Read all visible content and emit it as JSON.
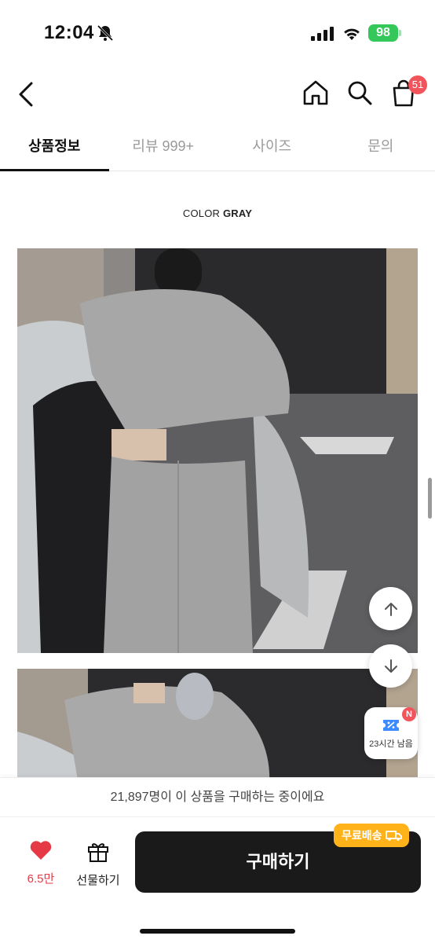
{
  "status_bar": {
    "time": "12:04",
    "battery": "98"
  },
  "navbar": {
    "cart_count": "51"
  },
  "tabs": [
    {
      "label": "상품정보",
      "active": true
    },
    {
      "label": "리뷰 999+",
      "active": false
    },
    {
      "label": "사이즈",
      "active": false
    },
    {
      "label": "문의",
      "active": false
    }
  ],
  "content": {
    "color_prefix": "COLOR",
    "color_value": "GRAY"
  },
  "coupon": {
    "badge": "N",
    "label": "23시간 남음"
  },
  "purchase_banner": {
    "text": "21,897명이 이 상품을 구매하는 중이에요"
  },
  "bottom_bar": {
    "like_count": "6.5만",
    "gift_label": "선물하기",
    "buy_label": "구매하기",
    "shipping_badge": "무료배송"
  },
  "colors": {
    "accent_red": "#f2545b",
    "buy_button": "#1a1a1a",
    "shipping_badge": "#ffb21a",
    "battery": "#34c759"
  },
  "icons": [
    "bell-slash-icon",
    "signal-icon",
    "wifi-icon",
    "back-arrow-icon",
    "home-icon",
    "search-icon",
    "shopping-bag-icon",
    "arrow-up-icon",
    "arrow-down-icon",
    "coupon-icon",
    "heart-icon",
    "gift-icon",
    "truck-icon"
  ]
}
